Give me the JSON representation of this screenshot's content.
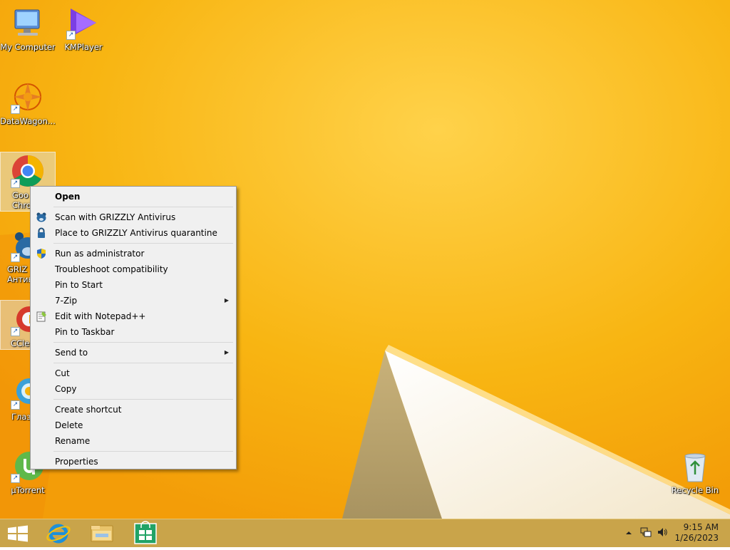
{
  "desktop": {
    "icons": [
      {
        "label": "My Computer",
        "icon": "computer-icon"
      },
      {
        "label": "KMPlayer",
        "icon": "kmplayer-icon"
      },
      {
        "label": "DataWagon...",
        "icon": "datawagon-icon"
      },
      {
        "label": "Goo\nChro",
        "icon": "chrome-icon"
      },
      {
        "label": "GRIZ\nАнтив",
        "icon": "grizzly-icon"
      },
      {
        "label": "CCle",
        "icon": "ccleaner-icon"
      },
      {
        "label": "Глаз",
        "icon": "glaz-icon"
      },
      {
        "label": "µTorrent",
        "icon": "utorrent-icon"
      },
      {
        "label": "Recycle Bin",
        "icon": "recycle-bin-icon"
      }
    ]
  },
  "context_menu": {
    "open": "Open",
    "scan_grizzly": "Scan with GRIZZLY Antivirus",
    "quarantine_grizzly": "Place to GRIZZLY Antivirus quarantine",
    "run_admin": "Run as administrator",
    "troubleshoot": "Troubleshoot compatibility",
    "pin_start": "Pin to Start",
    "zip": "7-Zip",
    "notepadpp": "Edit with Notepad++",
    "pin_taskbar": "Pin to Taskbar",
    "send_to": "Send to",
    "cut": "Cut",
    "copy": "Copy",
    "create_shortcut": "Create shortcut",
    "delete": "Delete",
    "rename": "Rename",
    "properties": "Properties"
  },
  "taskbar": {
    "pinned": [
      "start-button",
      "internet-explorer",
      "file-explorer",
      "windows-store"
    ],
    "clock": {
      "time": "9:15 AM",
      "date": "1/26/2023"
    }
  },
  "colors": {
    "wallpaper": "#f7b20b",
    "taskbar": "#c9a44a",
    "menu_bg": "#f0f0f0"
  }
}
